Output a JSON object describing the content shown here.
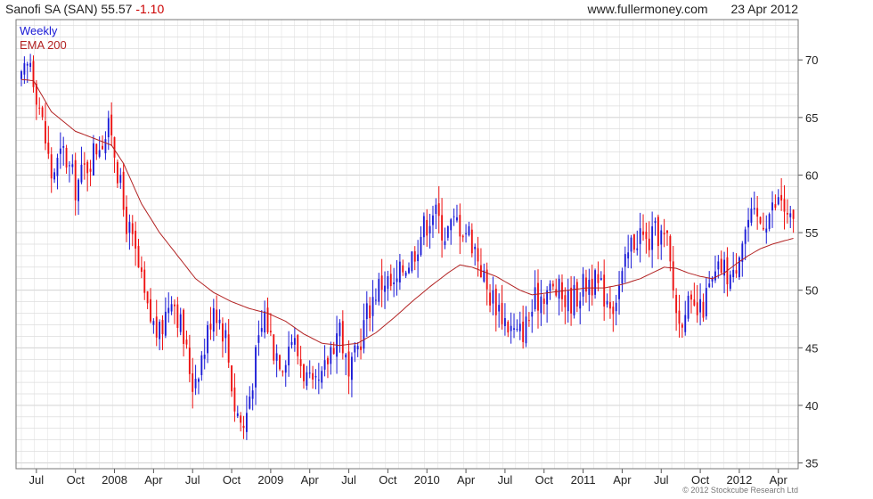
{
  "header": {
    "security": "Sanofi SA (SAN)",
    "last_price": "55.57",
    "change": "-1.10",
    "website": "www.fullermoney.com",
    "date": "23 Apr 2012"
  },
  "copyright": "© 2012 Stockcube Research Ltd",
  "chart_data": {
    "type": "candlestick",
    "frequency": "weekly",
    "legend": [
      {
        "name": "Weekly",
        "color": "#1a1ad6"
      },
      {
        "name": "EMA 200",
        "color": "#b22222"
      }
    ],
    "colors": {
      "up": "#1a1ad6",
      "down": "#ee1111",
      "ema": "#b22222",
      "grid": "#cccccc",
      "frame": "#777777"
    },
    "y_axis": {
      "position": "right",
      "ylim": [
        34.5,
        73.5
      ],
      "ticks": [
        35,
        40,
        45,
        50,
        55,
        60,
        65,
        70
      ]
    },
    "x_axis": {
      "tick_labels": [
        "Jul",
        "Oct",
        "2008",
        "Apr",
        "Jul",
        "Oct",
        "2009",
        "Apr",
        "Jul",
        "Oct",
        "2010",
        "Apr",
        "Jul",
        "Oct",
        "2011",
        "Apr",
        "Jul",
        "Oct",
        "2012",
        "Apr"
      ],
      "tick_weeks": [
        5,
        18,
        31,
        44,
        57,
        70,
        83,
        96,
        109,
        122,
        135,
        148,
        161,
        174,
        187,
        200,
        213,
        226,
        239,
        252
      ]
    },
    "close_path": [
      [
        0,
        68
      ],
      [
        3,
        70
      ],
      [
        6,
        66
      ],
      [
        10,
        60
      ],
      [
        14,
        62
      ],
      [
        18,
        59
      ],
      [
        22,
        61
      ],
      [
        26,
        63
      ],
      [
        30,
        64
      ],
      [
        34,
        57
      ],
      [
        38,
        53
      ],
      [
        42,
        48
      ],
      [
        46,
        46
      ],
      [
        50,
        50
      ],
      [
        53,
        47
      ],
      [
        57,
        42
      ],
      [
        61,
        45
      ],
      [
        64,
        49
      ],
      [
        68,
        46
      ],
      [
        71,
        40
      ],
      [
        74,
        38
      ],
      [
        78,
        44
      ],
      [
        81,
        48
      ],
      [
        84,
        45
      ],
      [
        87,
        44
      ],
      [
        90,
        46
      ],
      [
        94,
        43
      ],
      [
        97,
        41
      ],
      [
        100,
        42
      ],
      [
        103,
        45
      ],
      [
        106,
        47
      ],
      [
        109,
        42
      ],
      [
        112,
        45
      ],
      [
        115,
        48
      ],
      [
        118,
        50
      ],
      [
        121,
        51
      ],
      [
        124,
        50
      ],
      [
        127,
        52
      ],
      [
        130,
        53
      ],
      [
        133,
        55
      ],
      [
        137,
        57
      ],
      [
        141,
        55
      ],
      [
        145,
        56
      ],
      [
        149,
        55
      ],
      [
        152,
        53
      ],
      [
        155,
        50
      ],
      [
        158,
        49
      ],
      [
        162,
        47
      ],
      [
        165,
        46
      ],
      [
        168,
        47
      ],
      [
        171,
        49
      ],
      [
        174,
        50
      ],
      [
        178,
        50
      ],
      [
        182,
        49
      ],
      [
        186,
        50
      ],
      [
        189,
        51
      ],
      [
        193,
        50
      ],
      [
        197,
        49
      ],
      [
        200,
        51
      ],
      [
        203,
        54
      ],
      [
        206,
        55
      ],
      [
        208,
        54
      ],
      [
        212,
        55
      ],
      [
        215,
        54
      ],
      [
        217,
        50
      ],
      [
        219,
        47
      ],
      [
        221,
        49
      ],
      [
        223,
        48
      ],
      [
        226,
        48
      ],
      [
        229,
        50
      ],
      [
        233,
        52
      ],
      [
        237,
        51
      ],
      [
        239,
        54
      ],
      [
        242,
        56
      ],
      [
        246,
        56
      ],
      [
        250,
        57
      ],
      [
        253,
        58
      ],
      [
        255,
        56
      ],
      [
        257,
        55.6
      ]
    ],
    "ema_path": [
      [
        0,
        68.3
      ],
      [
        4,
        68.2
      ],
      [
        10,
        65.5
      ],
      [
        18,
        63.8
      ],
      [
        26,
        63.0
      ],
      [
        30,
        62.6
      ],
      [
        34,
        61.0
      ],
      [
        40,
        57.5
      ],
      [
        46,
        55.0
      ],
      [
        52,
        53.0
      ],
      [
        58,
        51.0
      ],
      [
        64,
        49.8
      ],
      [
        70,
        49.0
      ],
      [
        76,
        48.4
      ],
      [
        82,
        48.0
      ],
      [
        88,
        47.3
      ],
      [
        94,
        46.2
      ],
      [
        100,
        45.4
      ],
      [
        106,
        45.2
      ],
      [
        112,
        45.4
      ],
      [
        118,
        46.3
      ],
      [
        124,
        47.6
      ],
      [
        130,
        49.0
      ],
      [
        136,
        50.3
      ],
      [
        142,
        51.5
      ],
      [
        146,
        52.2
      ],
      [
        150,
        52.0
      ],
      [
        154,
        51.6
      ],
      [
        158,
        51.2
      ],
      [
        162,
        50.6
      ],
      [
        166,
        50.0
      ],
      [
        170,
        49.6
      ],
      [
        176,
        49.8
      ],
      [
        182,
        50.0
      ],
      [
        188,
        50.2
      ],
      [
        194,
        50.2
      ],
      [
        200,
        50.5
      ],
      [
        206,
        51.0
      ],
      [
        210,
        51.5
      ],
      [
        214,
        52.0
      ],
      [
        218,
        51.9
      ],
      [
        222,
        51.5
      ],
      [
        226,
        51.2
      ],
      [
        230,
        51.0
      ],
      [
        234,
        51.5
      ],
      [
        238,
        52.3
      ],
      [
        242,
        53.0
      ],
      [
        246,
        53.6
      ],
      [
        250,
        54.0
      ],
      [
        254,
        54.3
      ],
      [
        257,
        54.5
      ]
    ],
    "weeks": 258
  }
}
